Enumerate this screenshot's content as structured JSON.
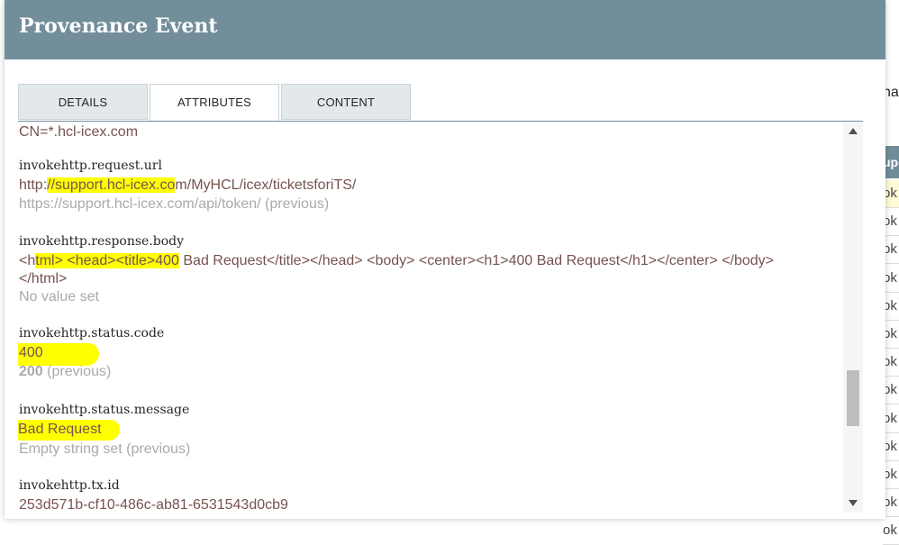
{
  "background": {
    "right_text": "na",
    "table_header": "upc",
    "rows": [
      "ok",
      "ok",
      "ok",
      "ok",
      "ok",
      "ok",
      "ok",
      "ok",
      "ok",
      "ok",
      "ok",
      "ok",
      "ok"
    ]
  },
  "dialog": {
    "title": "Provenance Event",
    "tabs": [
      {
        "label": "DETAILS",
        "active": false
      },
      {
        "label": "ATTRIBUTES",
        "active": true
      },
      {
        "label": "CONTENT",
        "active": false
      }
    ]
  },
  "attributes": {
    "partial_value": "CN=*.hcl-icex.com",
    "request_url": {
      "name": "invokehttp.request.url",
      "value_pre": "http:",
      "value_hl": "//support.hcl-icex.co",
      "value_post": "m/MyHCL/icex/ticketsforiTS/",
      "previous_value": "https://support.hcl-icex.com/api/token/",
      "previous_suffix": "(previous)"
    },
    "response_body": {
      "name": "invokehttp.response.body",
      "value_pre": "<h",
      "value_hl": "tml> <head><title>400",
      "value_post": " Bad Request</title></head> <body> <center><h1>400 Bad Request</h1></center> </body>",
      "value_line2": "</html>",
      "previous_value": "No value set"
    },
    "status_code": {
      "name": "invokehttp.status.code",
      "value": "400",
      "previous_value": "200",
      "previous_suffix": "(previous)"
    },
    "status_message": {
      "name": "invokehttp.status.message",
      "value": "Bad Request",
      "previous_value": "Empty string set (previous)"
    },
    "tx_id": {
      "name": "invokehttp.tx.id",
      "value": "253d571b-cf10-486c-ab81-6531543d0cb9"
    }
  },
  "colors": {
    "header_bg": "#728e9b",
    "value_text": "#775351",
    "previous_text": "#aaaaaa",
    "highlight": "#ffff00"
  }
}
